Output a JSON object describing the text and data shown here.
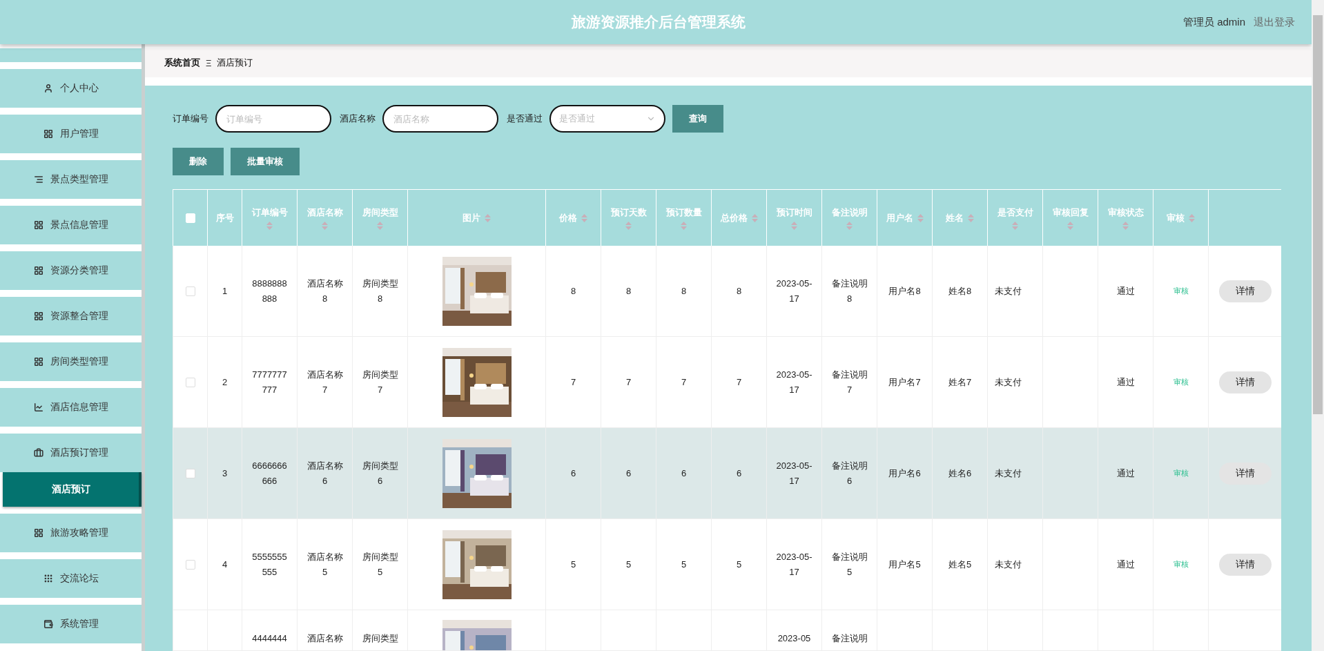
{
  "header": {
    "title": "旅游资源推介后台管理系统",
    "user": "管理员 admin",
    "logout": "退出登录"
  },
  "breadcrumb": {
    "home": "系统首页",
    "separator": "Ξ",
    "current": "酒店预订"
  },
  "sidebar": {
    "items": [
      {
        "label": "个人中心",
        "selected": false
      },
      {
        "label": "用户管理",
        "selected": false
      },
      {
        "label": "景点类型管理",
        "selected": false
      },
      {
        "label": "景点信息管理",
        "selected": false
      },
      {
        "label": "资源分类管理",
        "selected": false
      },
      {
        "label": "资源整合管理",
        "selected": false
      },
      {
        "label": "房间类型管理",
        "selected": false
      },
      {
        "label": "酒店信息管理",
        "selected": false
      },
      {
        "label": "酒店预订管理",
        "selected": false,
        "expanded": true,
        "children": [
          {
            "label": "酒店预订",
            "selected": true
          }
        ]
      },
      {
        "label": "旅游攻略管理",
        "selected": false
      },
      {
        "label": "交流论坛",
        "selected": false
      },
      {
        "label": "系统管理",
        "selected": false
      }
    ]
  },
  "search": {
    "fields": [
      {
        "kind": "input",
        "label": "订单编号",
        "placeholder": "订单编号"
      },
      {
        "kind": "input",
        "label": "酒店名称",
        "placeholder": "酒店名称"
      },
      {
        "kind": "select",
        "label": "是否通过",
        "placeholder": "是否通过"
      }
    ],
    "button": "查询"
  },
  "actions": [
    "删除",
    "批量审核"
  ],
  "table": {
    "header_checked": false,
    "columns": [
      {
        "label": "序号",
        "sortable": false
      },
      {
        "label": "订单编号",
        "sortable": true
      },
      {
        "label": "酒店名称",
        "sortable": true
      },
      {
        "label": "房间类型",
        "sortable": true
      },
      {
        "label": "图片",
        "sortable": true
      },
      {
        "label": "价格",
        "sortable": true
      },
      {
        "label": "预订天数",
        "sortable": true
      },
      {
        "label": "预订数量",
        "sortable": true
      },
      {
        "label": "总价格",
        "sortable": true
      },
      {
        "label": "预订时间",
        "sortable": true
      },
      {
        "label": "备注说明",
        "sortable": true
      },
      {
        "label": "用户名",
        "sortable": true
      },
      {
        "label": "姓名",
        "sortable": true
      },
      {
        "label": "是否支付",
        "sortable": true
      },
      {
        "label": "审核回复",
        "sortable": true
      },
      {
        "label": "审核状态",
        "sortable": true
      },
      {
        "label": "审核",
        "sortable": true
      }
    ],
    "rows": [
      {
        "checked": false,
        "selected": false,
        "index": "1",
        "order_no": "8888888888",
        "hotel": "酒店名称8",
        "room_type": "房间类型8",
        "price": "8",
        "days": "8",
        "quantity": "8",
        "total": "8",
        "time": "2023-05-17",
        "note": "备注说明8",
        "username": "用户名8",
        "name": "姓名8",
        "paid": "未支付",
        "status": "通过",
        "review_link": "审核",
        "details": "详情"
      },
      {
        "checked": false,
        "selected": false,
        "index": "2",
        "order_no": "7777777777",
        "hotel": "酒店名称7",
        "room_type": "房间类型7",
        "price": "7",
        "days": "7",
        "quantity": "7",
        "total": "7",
        "time": "2023-05-17",
        "note": "备注说明7",
        "username": "用户名7",
        "name": "姓名7",
        "paid": "未支付",
        "status": "通过",
        "review_link": "审核",
        "details": "详情"
      },
      {
        "checked": false,
        "selected": true,
        "index": "3",
        "order_no": "6666666666",
        "hotel": "酒店名称6",
        "room_type": "房间类型6",
        "price": "6",
        "days": "6",
        "quantity": "6",
        "total": "6",
        "time": "2023-05-17",
        "note": "备注说明6",
        "username": "用户名6",
        "name": "姓名6",
        "paid": "未支付",
        "status": "通过",
        "review_link": "审核",
        "details": "详情"
      },
      {
        "checked": false,
        "selected": false,
        "index": "4",
        "order_no": "5555555555",
        "hotel": "酒店名称5",
        "room_type": "房间类型5",
        "price": "5",
        "days": "5",
        "quantity": "5",
        "total": "5",
        "time": "2023-05-17",
        "note": "备注说明5",
        "username": "用户名5",
        "name": "姓名5",
        "paid": "未支付",
        "status": "通过",
        "review_link": "审核",
        "details": "详情"
      },
      {
        "selected": false,
        "order_no": "4444444",
        "hotel": "酒店名称",
        "room_type": "房间类型",
        "time": "2023-05",
        "note": "备注说明"
      }
    ]
  }
}
